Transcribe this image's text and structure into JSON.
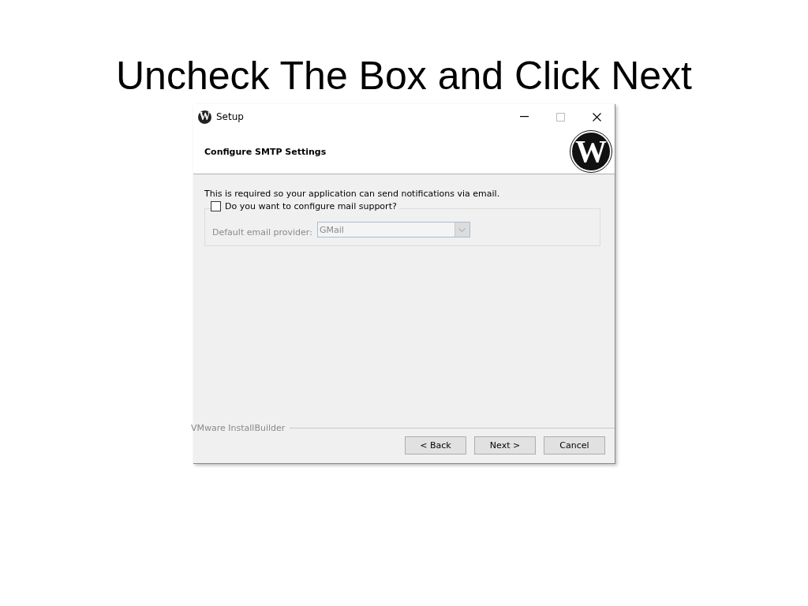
{
  "slide": {
    "title": "Uncheck The Box and Click Next"
  },
  "window": {
    "title": "Setup",
    "icon_letter": "W"
  },
  "header": {
    "title": "Configure SMTP Settings",
    "logo_letter": "W"
  },
  "body": {
    "description": "This is required so your application can send notifications via email.",
    "mail_checkbox": {
      "label": "Do you want to configure mail support?",
      "checked": false
    },
    "provider": {
      "label": "Default email provider:",
      "value": "GMail",
      "disabled": true
    }
  },
  "footer": {
    "brand": "VMware InstallBuilder",
    "buttons": [
      {
        "label": "< Back"
      },
      {
        "label": "Next >"
      },
      {
        "label": "Cancel"
      }
    ]
  }
}
